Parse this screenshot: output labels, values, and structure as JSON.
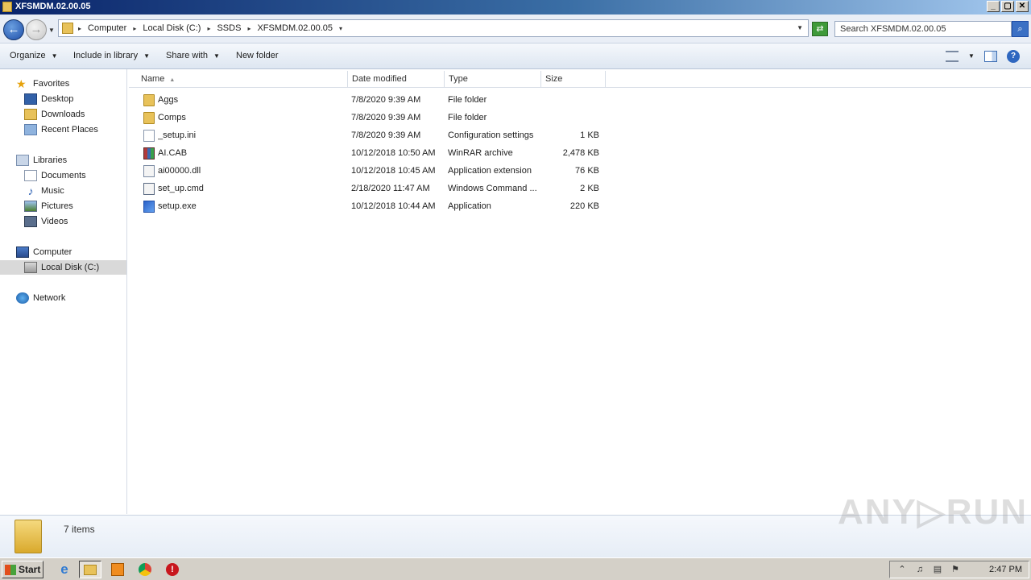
{
  "window": {
    "title": "XFSMDM.02.00.05",
    "buttons": [
      "_",
      "▢",
      "✕"
    ]
  },
  "address": {
    "crumbs": [
      "Computer",
      "Local Disk (C:)",
      "SSDS",
      "XFSMDM.02.00.05"
    ],
    "search_placeholder": "Search XFSMDM.02.00.05"
  },
  "toolbar": {
    "organize": "Organize",
    "include_library": "Include in library",
    "share_with": "Share with",
    "new_folder": "New folder"
  },
  "nav": {
    "favorites": "Favorites",
    "desktop": "Desktop",
    "downloads": "Downloads",
    "recent_places": "Recent Places",
    "libraries": "Libraries",
    "documents": "Documents",
    "music": "Music",
    "pictures": "Pictures",
    "videos": "Videos",
    "computer": "Computer",
    "local_disk": "Local Disk (C:)",
    "network": "Network"
  },
  "columns": {
    "name": "Name",
    "date": "Date modified",
    "type": "Type",
    "size": "Size"
  },
  "files": [
    {
      "name": "Aggs",
      "date": "7/8/2020 9:39 AM",
      "type": "File folder",
      "size": "",
      "icon": "folder-icon"
    },
    {
      "name": "Comps",
      "date": "7/8/2020 9:39 AM",
      "type": "File folder",
      "size": "",
      "icon": "folder-icon"
    },
    {
      "name": "_setup.ini",
      "date": "7/8/2020 9:39 AM",
      "type": "Configuration settings",
      "size": "1 KB",
      "icon": "ini-file-icon"
    },
    {
      "name": "AI.CAB",
      "date": "10/12/2018 10:50 AM",
      "type": "WinRAR archive",
      "size": "2,478 KB",
      "icon": "winrar-archive-icon"
    },
    {
      "name": "ai00000.dll",
      "date": "10/12/2018 10:45 AM",
      "type": "Application extension",
      "size": "76 KB",
      "icon": "dll-file-icon"
    },
    {
      "name": "set_up.cmd",
      "date": "2/18/2020 11:47 AM",
      "type": "Windows Command ...",
      "size": "2 KB",
      "icon": "cmd-file-icon"
    },
    {
      "name": "setup.exe",
      "date": "10/12/2018 10:44 AM",
      "type": "Application",
      "size": "220 KB",
      "icon": "exe-file-icon"
    }
  ],
  "details": {
    "count": "7 items"
  },
  "watermark": "ANY▷RUN",
  "taskbar": {
    "start": "Start",
    "clock": "2:47 PM"
  }
}
